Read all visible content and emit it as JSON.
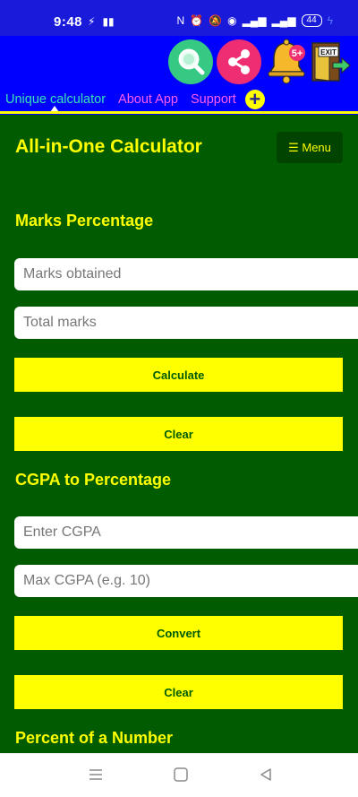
{
  "status_bar": {
    "time": "9:48",
    "battery": "44"
  },
  "header": {
    "icons": [
      "search-icon",
      "share-icon",
      "bell-icon",
      "exit-icon"
    ],
    "notification_badge": "5+",
    "exit_label": "EXIT"
  },
  "tabs": [
    {
      "label": "Unique calculator",
      "active": true
    },
    {
      "label": "About App",
      "active": false
    },
    {
      "label": "Support",
      "active": false
    }
  ],
  "tab_add": "+",
  "main": {
    "title": "All-in-One Calculator",
    "menu_label": "☰ Menu",
    "sections": [
      {
        "title": "Marks Percentage",
        "inputs": [
          {
            "placeholder": "Marks obtained",
            "value": ""
          },
          {
            "placeholder": "Total marks",
            "value": ""
          }
        ],
        "buttons": [
          "Calculate",
          "Clear"
        ]
      },
      {
        "title": "CGPA to Percentage",
        "inputs": [
          {
            "placeholder": "Enter CGPA",
            "value": ""
          },
          {
            "placeholder": "Max CGPA (e.g. 10)",
            "value": ""
          }
        ],
        "buttons": [
          "Convert",
          "Clear"
        ]
      },
      {
        "title": "Percent of a Number"
      }
    ]
  },
  "colors": {
    "status_bar": "#1a1adb",
    "header": "#0000ff",
    "main_bg": "#015b00",
    "accent_yellow": "#ffff00",
    "active_tab": "#38e2b8",
    "inactive_tab": "#ff5cf0"
  }
}
